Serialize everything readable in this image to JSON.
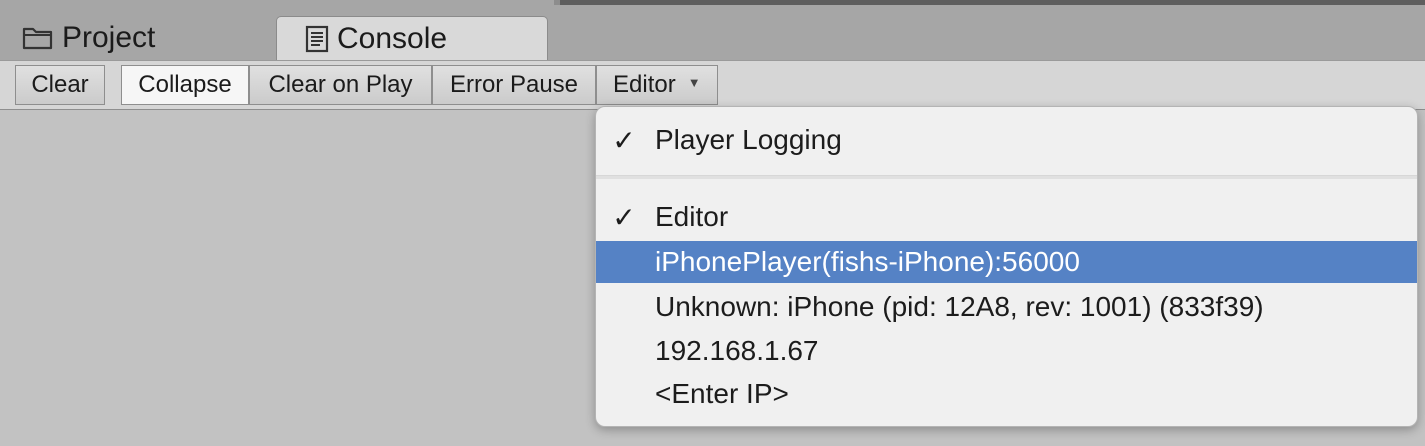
{
  "tabs": [
    {
      "label": "Project",
      "icon": "folder-icon",
      "active": false
    },
    {
      "label": "Console",
      "icon": "console-icon",
      "active": true
    }
  ],
  "toolbar": {
    "clear_label": "Clear",
    "collapse_label": "Collapse",
    "clear_on_play_label": "Clear on Play",
    "error_pause_label": "Error Pause",
    "editor_label": "Editor",
    "editor_caret": "▼"
  },
  "dropdown": {
    "check_mark": "✓",
    "items": [
      {
        "label": "Player Logging",
        "checked": true
      },
      {
        "label": "Editor",
        "checked": true
      },
      {
        "label": "iPhonePlayer(fishs-iPhone):56000",
        "checked": false,
        "highlighted": true
      },
      {
        "label": "Unknown: iPhone (pid: 12A8, rev: 1001) (833f39)",
        "checked": false
      },
      {
        "label": "192.168.1.67",
        "checked": false
      },
      {
        "label": "<Enter IP>",
        "checked": false
      }
    ]
  },
  "colors": {
    "highlight": "#5582c5",
    "panel_background": "#c2c2c2",
    "menu_background": "#f0f0f0"
  }
}
